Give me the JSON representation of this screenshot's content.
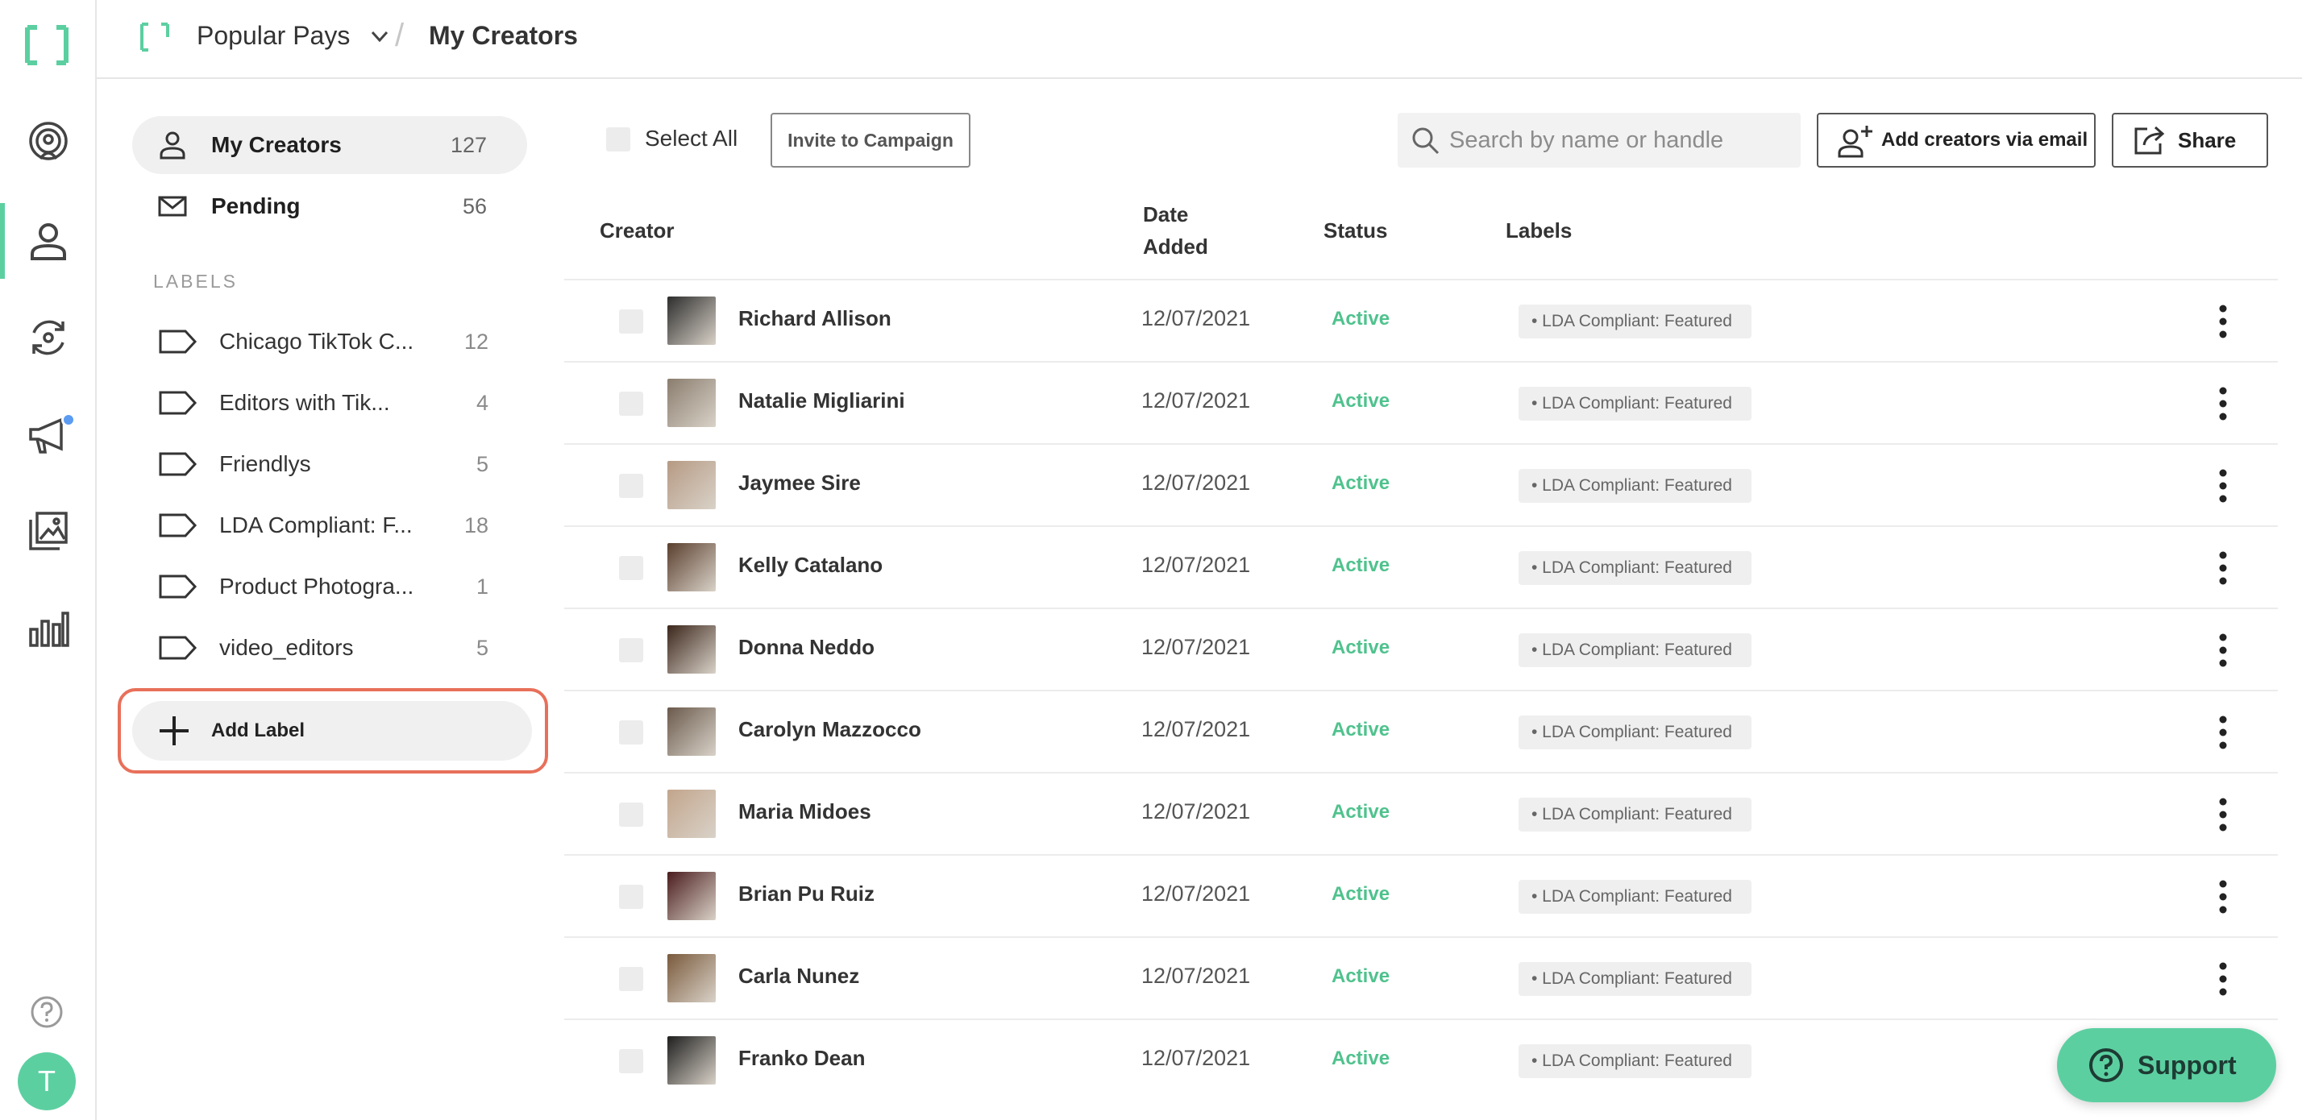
{
  "topbar": {
    "company": "Popular Pays",
    "page": "My Creators"
  },
  "sidebar": {
    "nav": [
      {
        "label": "My Creators",
        "count": "127"
      },
      {
        "label": "Pending",
        "count": "56"
      }
    ],
    "labels_heading": "LABELS",
    "labels": [
      {
        "label": "Chicago TikTok C...",
        "count": "12"
      },
      {
        "label": "Editors with Tik...",
        "count": "4"
      },
      {
        "label": "Friendlys",
        "count": "5"
      },
      {
        "label": "LDA Compliant: F...",
        "count": "18"
      },
      {
        "label": "Product Photogra...",
        "count": "1"
      },
      {
        "label": "video_editors",
        "count": "5"
      }
    ],
    "add_label": "Add Label"
  },
  "toolbar": {
    "select_all": "Select All",
    "invite": "Invite to Campaign",
    "search_placeholder": "Search by name or handle",
    "add_email": "Add creators via email",
    "share": "Share"
  },
  "table": {
    "headers": {
      "creator": "Creator",
      "date_line1": "Date",
      "date_line2": "Added",
      "status": "Status",
      "labels": "Labels"
    },
    "rows": [
      {
        "name": "Richard Allison",
        "date": "12/07/2021",
        "status": "Active",
        "label": "• LDA Compliant: Featured"
      },
      {
        "name": "Natalie Migliarini",
        "date": "12/07/2021",
        "status": "Active",
        "label": "• LDA Compliant: Featured"
      },
      {
        "name": "Jaymee Sire",
        "date": "12/07/2021",
        "status": "Active",
        "label": "• LDA Compliant: Featured"
      },
      {
        "name": "Kelly Catalano",
        "date": "12/07/2021",
        "status": "Active",
        "label": "• LDA Compliant: Featured"
      },
      {
        "name": "Donna Neddo",
        "date": "12/07/2021",
        "status": "Active",
        "label": "• LDA Compliant: Featured"
      },
      {
        "name": "Carolyn Mazzocco",
        "date": "12/07/2021",
        "status": "Active",
        "label": "• LDA Compliant: Featured"
      },
      {
        "name": "Maria Midoes",
        "date": "12/07/2021",
        "status": "Active",
        "label": "• LDA Compliant: Featured"
      },
      {
        "name": "Brian Pu Ruiz",
        "date": "12/07/2021",
        "status": "Active",
        "label": "• LDA Compliant: Featured"
      },
      {
        "name": "Carla Nunez",
        "date": "12/07/2021",
        "status": "Active",
        "label": "• LDA Compliant: Featured"
      },
      {
        "name": "Franko Dean",
        "date": "12/07/2021",
        "status": "Active",
        "label": "• LDA Compliant: Featured"
      }
    ]
  },
  "support": "Support",
  "user": {
    "initial": "T"
  },
  "colors": {
    "accent": "#5ccfa1",
    "status_active": "#4fc28d",
    "highlight": "#e8705a",
    "notification": "#5b9cf2"
  }
}
